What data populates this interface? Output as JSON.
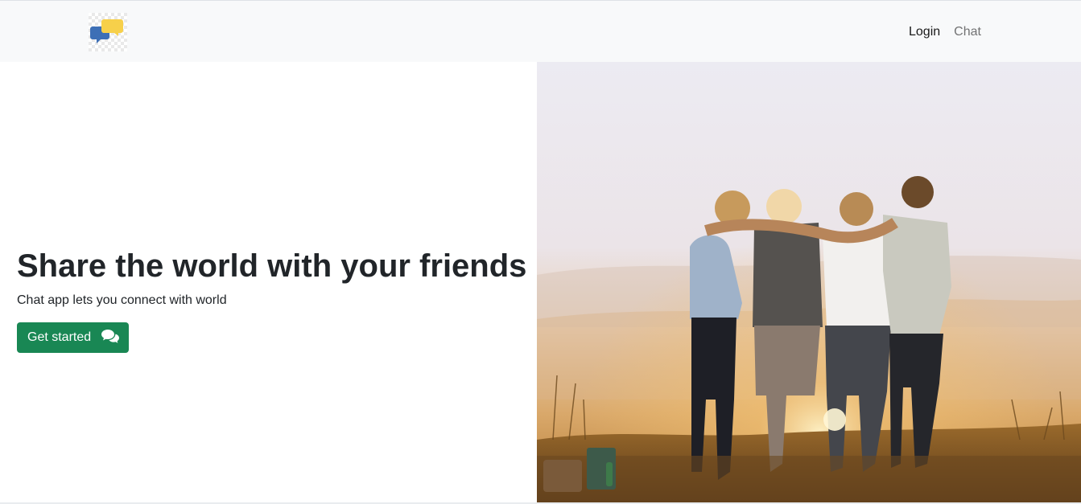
{
  "navbar": {
    "brand_icon": "chat-bubbles-logo",
    "links": [
      {
        "label": "Login",
        "active": true
      },
      {
        "label": "Chat",
        "active": false
      }
    ]
  },
  "hero": {
    "headline": "Share the world with your friends",
    "subtext": "Chat app lets you connect with world",
    "cta_label": "Get started",
    "cta_icon": "comments-icon",
    "image_subject": "photo"
  },
  "colors": {
    "navbar_bg": "#f8f9fa",
    "cta_bg": "#198754",
    "logo_blue": "#3d6fb6",
    "logo_yellow": "#f7d04a"
  }
}
